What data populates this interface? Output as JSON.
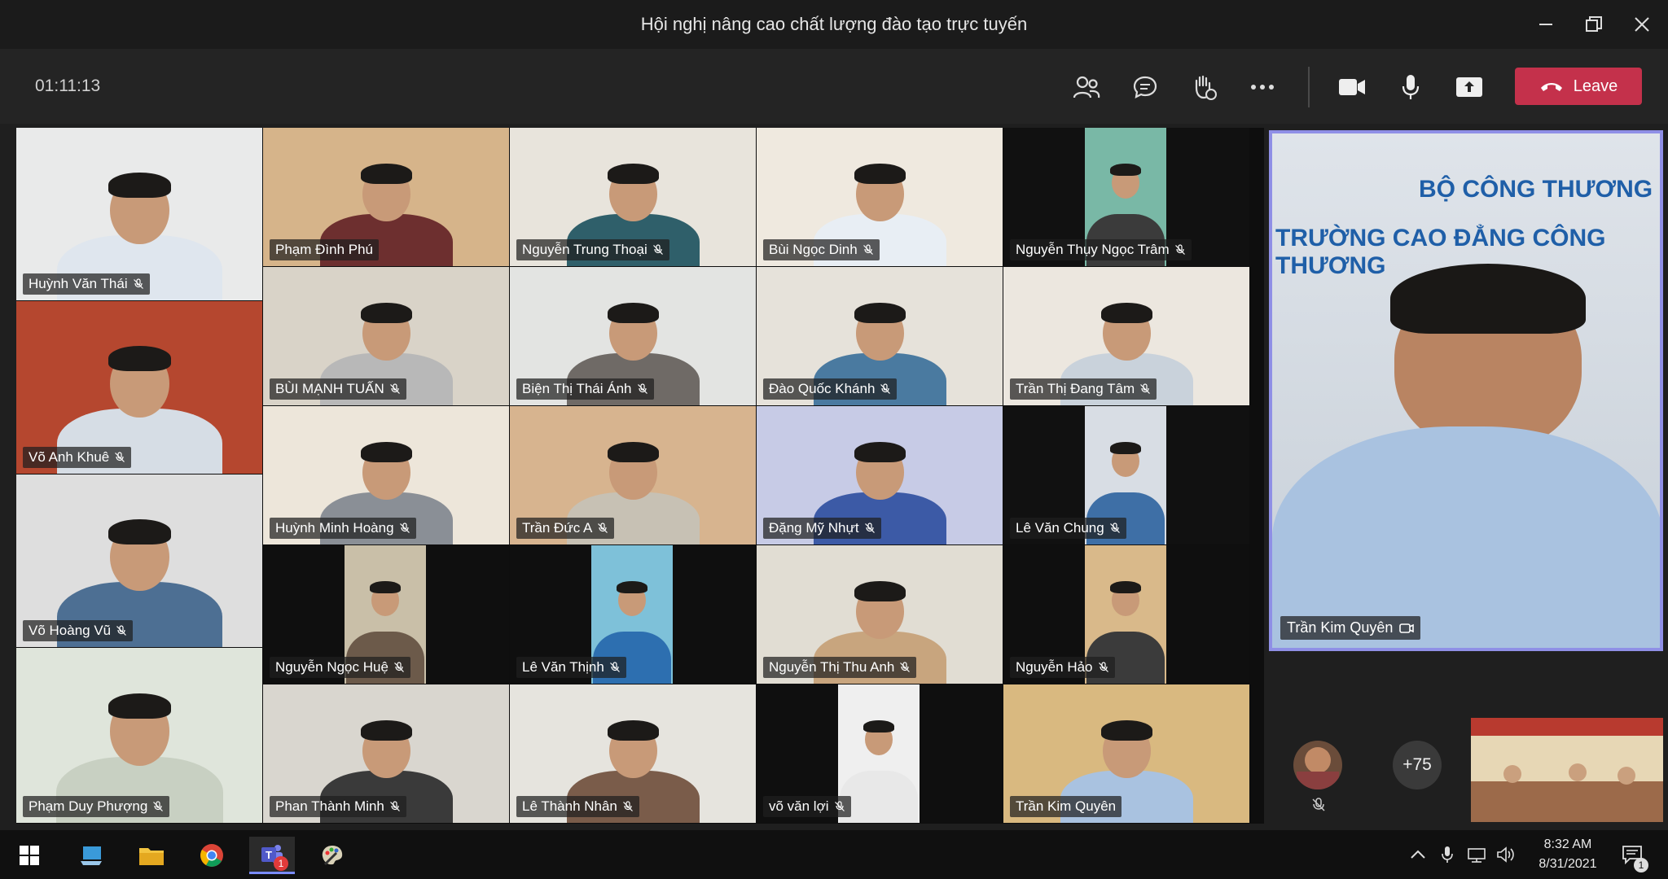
{
  "window": {
    "title": "Hội nghị nâng cao chất lượng đào tạo trực tuyến"
  },
  "toolbar": {
    "timer": "01:11:13",
    "buttons": [
      "people-icon",
      "chat-icon",
      "raise-hand-icon",
      "more-icon",
      "camera-icon",
      "mic-icon",
      "share-icon"
    ],
    "leave_label": "Leave",
    "leave_color": "#c4314b"
  },
  "participants": [
    "Huỳnh Văn Thái",
    "Phạm Đình Phú",
    "Nguyễn Trung Thoại",
    "Bùi Ngọc Dinh",
    "Nguyễn Thụy Ngọc Trâm",
    "Võ Anh Khuê",
    "BÙI MẠNH TUẤN",
    "Biện Thị Thái Ánh",
    "Đào Quốc Khánh",
    "Trần Thị Đang Tâm",
    "Huỳnh Minh Hoàng",
    "Trần Đức A",
    "Đặng Mỹ Nhựt",
    "Lê Văn  Chung",
    "Võ Hoàng Vũ",
    "Nguyễn Ngọc Huệ",
    "Lê Văn Thịnh",
    "Nguyễn Thị Thu Anh",
    "Nguyễn Hảo",
    "Phạm Duy Phượng",
    "Phan Thành Minh",
    "Lê Thành Nhân",
    "võ văn lợi",
    "Trần Kim Quyên"
  ],
  "spotlight": {
    "name": "Trần Kim Quyên",
    "accent": "#8f8fe6"
  },
  "overflow": {
    "count": "+75"
  },
  "taskbar": {
    "time": "8:32 AM",
    "date": "8/31/2021",
    "teams_badge": "1",
    "notifications_badge": "1"
  }
}
